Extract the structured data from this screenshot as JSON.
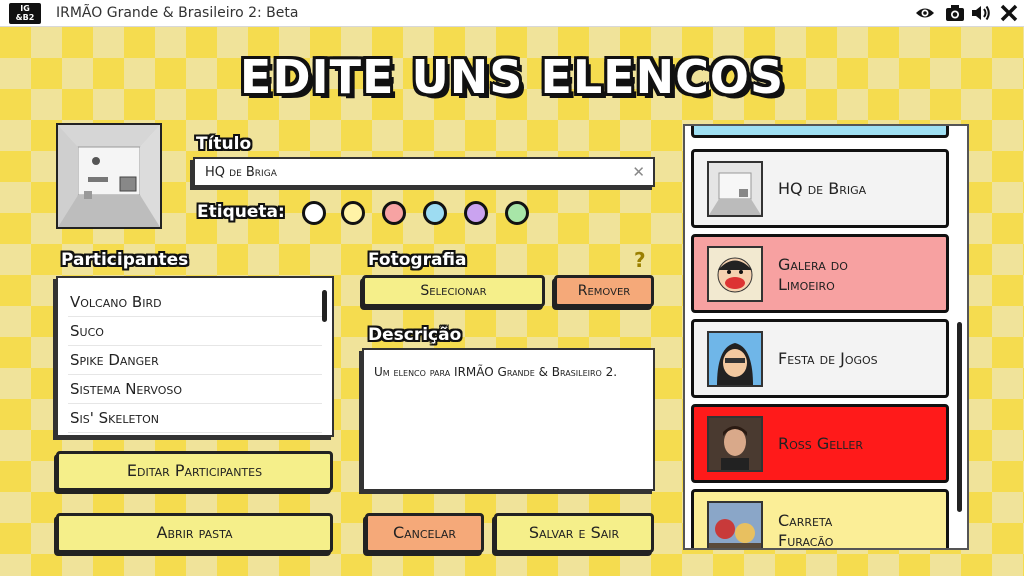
{
  "window": {
    "title": "IRMÃO Grande & Brasileiro 2: Beta",
    "logo_top": "IG",
    "logo_bottom": "&B2",
    "icons": [
      "eye-icon",
      "camera-icon",
      "speaker-icon",
      "close-icon"
    ]
  },
  "heading": "EDITE UNS ELENCOS",
  "title_field": {
    "label": "Título",
    "value": "HQ de Briga",
    "clear": "✕"
  },
  "tag": {
    "label": "Etiqueta:",
    "colors": [
      "#ffffff",
      "#fff3a6",
      "#f7a3a3",
      "#9ddcf2",
      "#caa3f0",
      "#a8e6a8"
    ]
  },
  "participants": {
    "label": "Participantes",
    "items": [
      "Volcano Bird",
      "Suco",
      "Spike Danger",
      "Sistema Nervoso",
      "Sis' Skeleton"
    ]
  },
  "photo": {
    "label": "Fotografia",
    "help": "?",
    "select_label": "Selecionar",
    "remove_label": "Remover"
  },
  "description": {
    "label": "Descrição",
    "text": "Um elenco para IRMÃO Grande & Brasileiro 2."
  },
  "buttons": {
    "edit_participants": "Editar Participantes",
    "open_folder": "Abrir pasta",
    "cancel": "Cancelar",
    "save_exit": "Salvar e Sair"
  },
  "casts": [
    {
      "name": "HQ de Briga",
      "color": "#f3f3f3"
    },
    {
      "name": "Galera do Limoeiro",
      "color": "#f7a1a1"
    },
    {
      "name": "Festa de Jogos",
      "color": "#f3f3f3"
    },
    {
      "name": "Ross Geller",
      "color": "#ff1a1a"
    },
    {
      "name": "Carreta Furacão",
      "color": "#fbee97"
    }
  ]
}
